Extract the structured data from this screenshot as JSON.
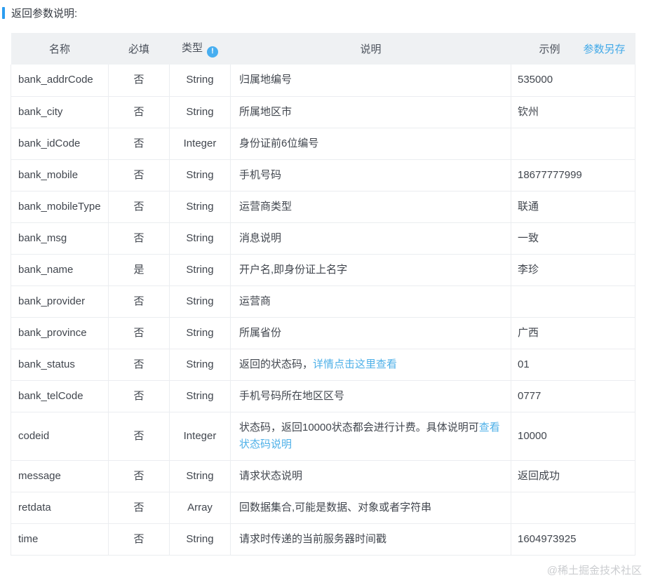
{
  "page": {
    "title": "返回参数说明:",
    "watermark": "@稀土掘金技术社区"
  },
  "colors": {
    "accent_blue": "#2b9df0",
    "link_blue": "#4eb0e8",
    "header_bg": "#eff1f3",
    "border": "#ebedf0",
    "text": "#41464e"
  },
  "table": {
    "headers": {
      "name": "名称",
      "required": "必填",
      "type": "类型",
      "type_info_icon": "!",
      "description": "说明",
      "example": "示例",
      "save_params": "参数另存"
    },
    "rows": [
      {
        "name": "bank_addrCode",
        "required": "否",
        "type": "String",
        "description": [
          {
            "text": "归属地编号"
          }
        ],
        "example": "535000"
      },
      {
        "name": "bank_city",
        "required": "否",
        "type": "String",
        "description": [
          {
            "text": "所属地区市"
          }
        ],
        "example": "钦州"
      },
      {
        "name": "bank_idCode",
        "required": "否",
        "type": "Integer",
        "description": [
          {
            "text": "身份证前6位编号"
          }
        ],
        "example": ""
      },
      {
        "name": "bank_mobile",
        "required": "否",
        "type": "String",
        "description": [
          {
            "text": "手机号码"
          }
        ],
        "example": "18677777999"
      },
      {
        "name": "bank_mobileType",
        "required": "否",
        "type": "String",
        "description": [
          {
            "text": "运营商类型"
          }
        ],
        "example": "联通"
      },
      {
        "name": "bank_msg",
        "required": "否",
        "type": "String",
        "description": [
          {
            "text": "消息说明"
          }
        ],
        "example": "一致"
      },
      {
        "name": "bank_name",
        "required": "是",
        "type": "String",
        "description": [
          {
            "text": "开户名,即身份证上名字"
          }
        ],
        "example": "李珍"
      },
      {
        "name": "bank_provider",
        "required": "否",
        "type": "String",
        "description": [
          {
            "text": "运营商"
          }
        ],
        "example": ""
      },
      {
        "name": "bank_province",
        "required": "否",
        "type": "String",
        "description": [
          {
            "text": "所属省份"
          }
        ],
        "example": "广西"
      },
      {
        "name": "bank_status",
        "required": "否",
        "type": "String",
        "description": [
          {
            "text": "返回的状态码，"
          },
          {
            "text": "详情点击这里查看",
            "link": true
          }
        ],
        "example": "01"
      },
      {
        "name": "bank_telCode",
        "required": "否",
        "type": "String",
        "description": [
          {
            "text": "手机号码所在地区区号"
          }
        ],
        "example": "0777"
      },
      {
        "name": "codeid",
        "required": "否",
        "type": "Integer",
        "description": [
          {
            "text": "状态码，返回10000状态都会进行计费。具体说明可"
          },
          {
            "text": "查看状态码说明",
            "link": true
          }
        ],
        "example": "10000"
      },
      {
        "name": "message",
        "required": "否",
        "type": "String",
        "description": [
          {
            "text": "请求状态说明"
          }
        ],
        "example": "返回成功"
      },
      {
        "name": "retdata",
        "required": "否",
        "type": "Array",
        "description": [
          {
            "text": "回数据集合,可能是数据、对象或者字符串"
          }
        ],
        "example": ""
      },
      {
        "name": "time",
        "required": "否",
        "type": "String",
        "description": [
          {
            "text": "请求时传递的当前服务器时间戳"
          }
        ],
        "example": "1604973925"
      }
    ]
  }
}
